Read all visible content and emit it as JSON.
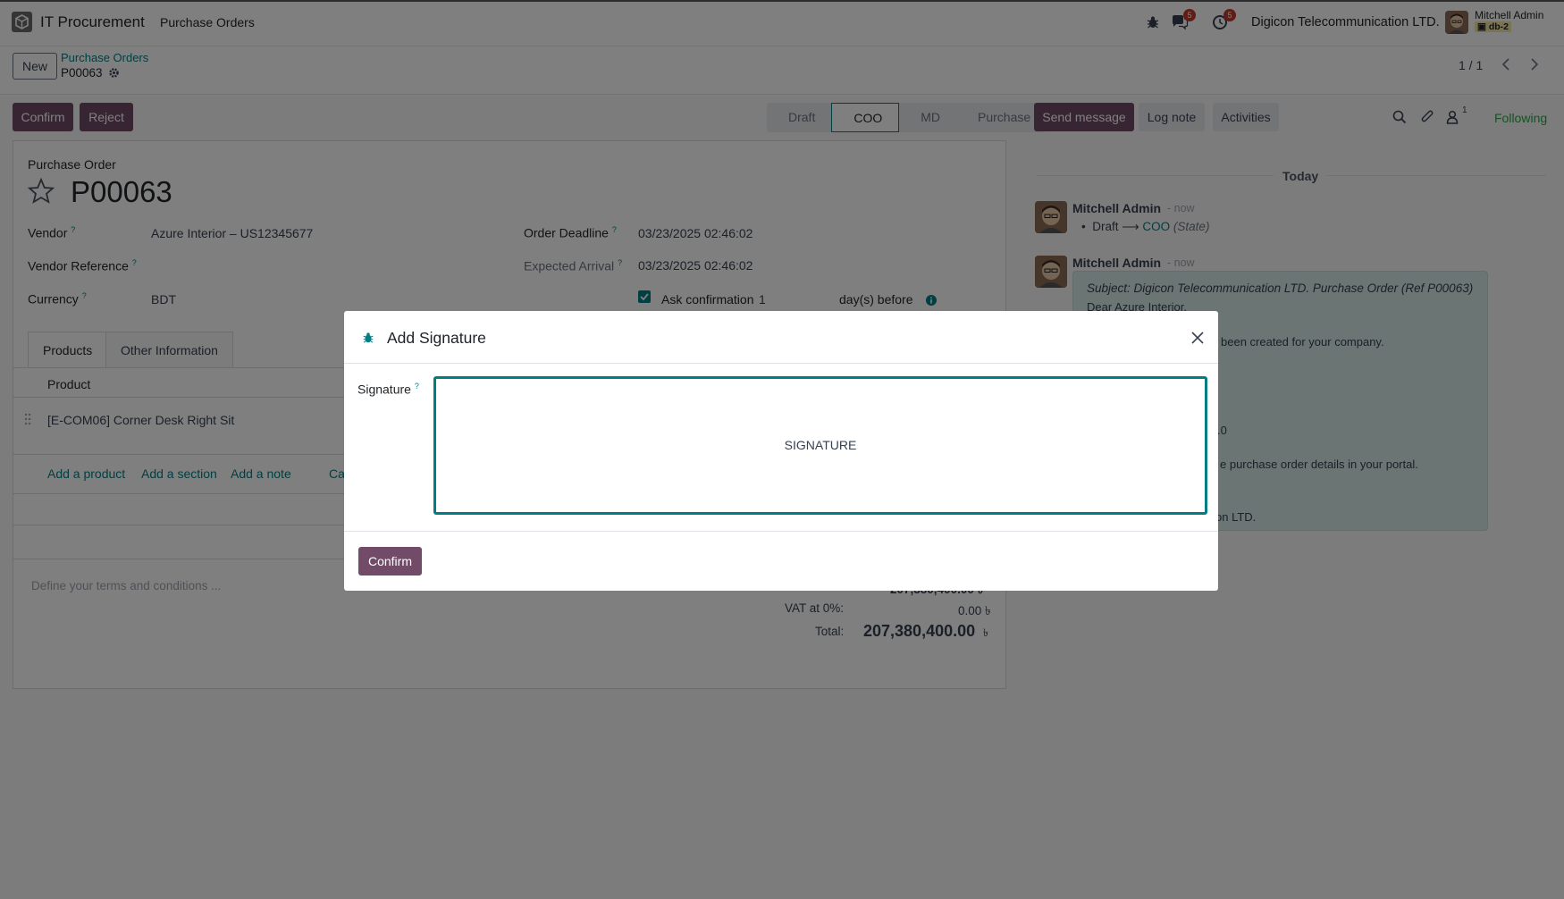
{
  "navbar": {
    "app_name": "IT Procurement",
    "menu_purchase_orders": "Purchase Orders",
    "messages_count": "5",
    "activities_count": "5",
    "company": "Digicon Telecommunication LTD.",
    "user_name": "Mitchell Admin",
    "db_name": "db-2"
  },
  "control": {
    "new_label": "New",
    "breadcrumb_parent": "Purchase Orders",
    "breadcrumb_current": "P00063",
    "pager": "1 / 1"
  },
  "actions": {
    "confirm": "Confirm",
    "reject": "Reject"
  },
  "status": {
    "steps": [
      "Draft",
      "COO",
      "MD",
      "Purchase"
    ],
    "active": "COO"
  },
  "form": {
    "doc_type": "Purchase Order",
    "name": "P00063",
    "vendor_label": "Vendor",
    "vendor_value": "Azure Interior – US12345677",
    "vendor_ref_label": "Vendor Reference",
    "currency_label": "Currency",
    "currency_value": "BDT",
    "order_deadline_label": "Order Deadline",
    "order_deadline_value": "03/23/2025 02:46:02",
    "expected_arrival_label": "Expected Arrival",
    "expected_arrival_value": "03/23/2025 02:46:02",
    "ask_confirmation_label": "Ask confirmation",
    "ask_confirmation_days": "1",
    "days_before_label": "day(s) before",
    "help_mark": "?"
  },
  "tabs": {
    "products": "Products",
    "other_info": "Other Information"
  },
  "lines": {
    "column_product": "Product",
    "row_product": "[E-COM06] Corner Desk Right Sit",
    "add_product": "Add a product",
    "add_section": "Add a section",
    "add_note": "Add a note",
    "catalog_partial": "Ca"
  },
  "terms_placeholder": "Define your terms and conditions ...",
  "totals": {
    "untaxed_label": "Untaxed Amount:",
    "untaxed_value": "207,380,400.00 ৳",
    "vat_label": "VAT at 0%:",
    "vat_value": "0.00 ৳",
    "total_label": "Total:",
    "total_value": "207,380,400.00",
    "currency_symbol": "৳"
  },
  "chatter": {
    "send_message": "Send message",
    "log_note": "Log note",
    "activities": "Activities",
    "followers_count": "1",
    "following": "Following",
    "date_separator": "Today",
    "msg1_author": "Mitchell Admin",
    "msg1_time": "- now",
    "msg1_from": "Draft",
    "msg1_arrow": "⟶",
    "msg1_to": "COO",
    "msg1_field": "(State)",
    "msg2_author": "Mitchell Admin",
    "msg2_time": "- now",
    "msg2_subject": "Subject: Digicon Telecommunication LTD. Purchase Order (Ref P00063)",
    "msg2_greeting": "Dear Azure Interior,",
    "msg2_line1": "been created for your company.",
    "msg2_line2": ".0",
    "msg2_line3": "e purchase order details in your portal.",
    "msg2_line4": "on LTD."
  },
  "modal": {
    "title": "Add Signature",
    "signature_label": "Signature",
    "signature_placeholder": "SIGNATURE",
    "confirm": "Confirm"
  },
  "colors": {
    "brand": "#714b67",
    "accent": "#017e84",
    "badge": "#c0392b"
  }
}
